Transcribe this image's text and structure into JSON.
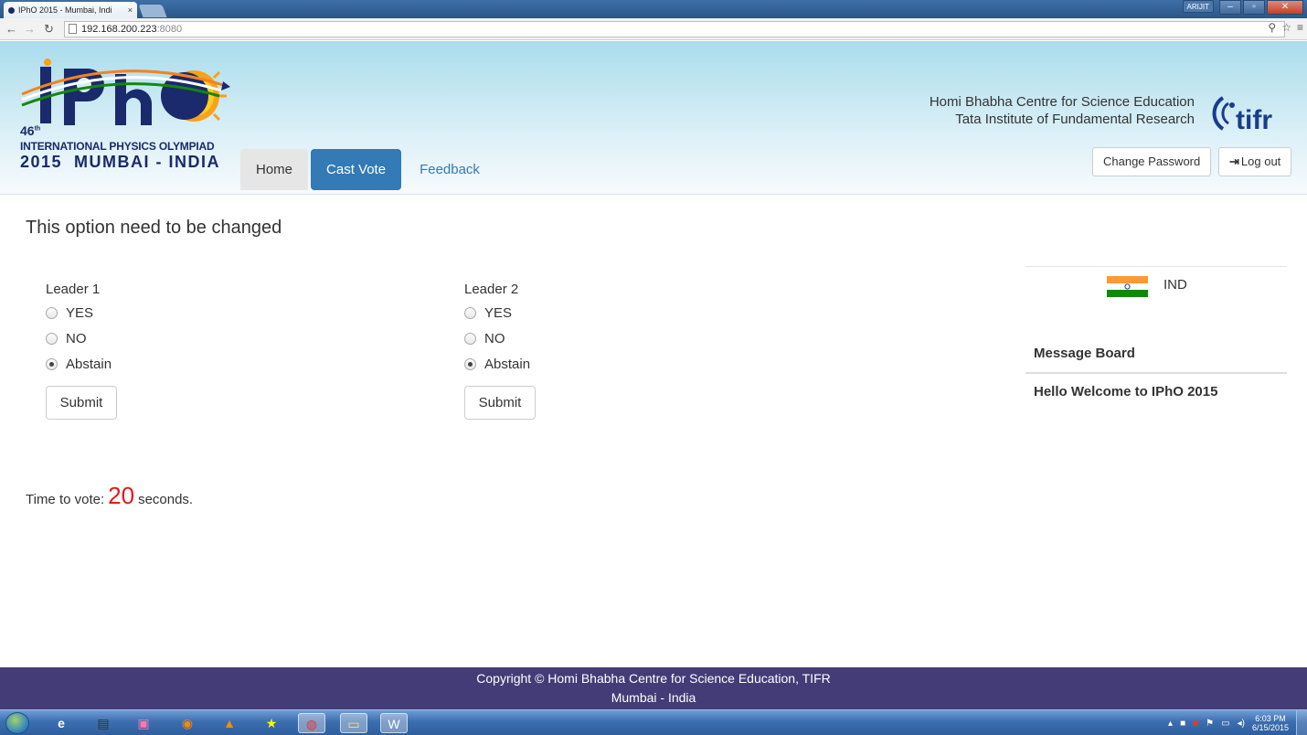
{
  "browser": {
    "tab_title": "IPhO 2015 - Mumbai, Indi",
    "tab_close": "×",
    "url_host": "192.168.200.223",
    "url_port": ":8080",
    "window_user": "ARIJIT"
  },
  "header": {
    "logo_number": "46",
    "logo_suffix": "th",
    "logo_line1": "INTERNATIONAL PHYSICS OLYMPIAD",
    "logo_line2": "2015  MUMBAI - INDIA",
    "nav": {
      "home": "Home",
      "cast_vote": "Cast Vote",
      "feedback": "Feedback"
    },
    "institute_line1": "Homi Bhabha Centre for Science Education",
    "institute_line2": "Tata Institute of Fundamental Research",
    "tifr_logo_text": "tifr",
    "change_password": "Change Password",
    "logout": "Log out"
  },
  "main": {
    "title": "This option need to be changed",
    "leaders": [
      {
        "name": "Leader 1",
        "options": [
          "YES",
          "NO",
          "Abstain"
        ],
        "selected": "Abstain",
        "submit": "Submit"
      },
      {
        "name": "Leader 2",
        "options": [
          "YES",
          "NO",
          "Abstain"
        ],
        "selected": "Abstain",
        "submit": "Submit"
      }
    ],
    "timer_prefix": "Time to vote:",
    "timer_value": "20",
    "timer_suffix": "seconds."
  },
  "sidebar": {
    "country": "IND",
    "message_board_title": "Message Board",
    "message": "Hello Welcome to IPhO 2015"
  },
  "footer": {
    "line1": "Copyright © Homi Bhabha Centre for Science Education, TIFR",
    "line2": "Mumbai - India"
  },
  "taskbar": {
    "time": "6:03 PM",
    "date": "6/15/2015"
  },
  "colors": {
    "primary": "#337ab7",
    "footer_bg": "#433c77",
    "timer": "#e21a1a"
  }
}
